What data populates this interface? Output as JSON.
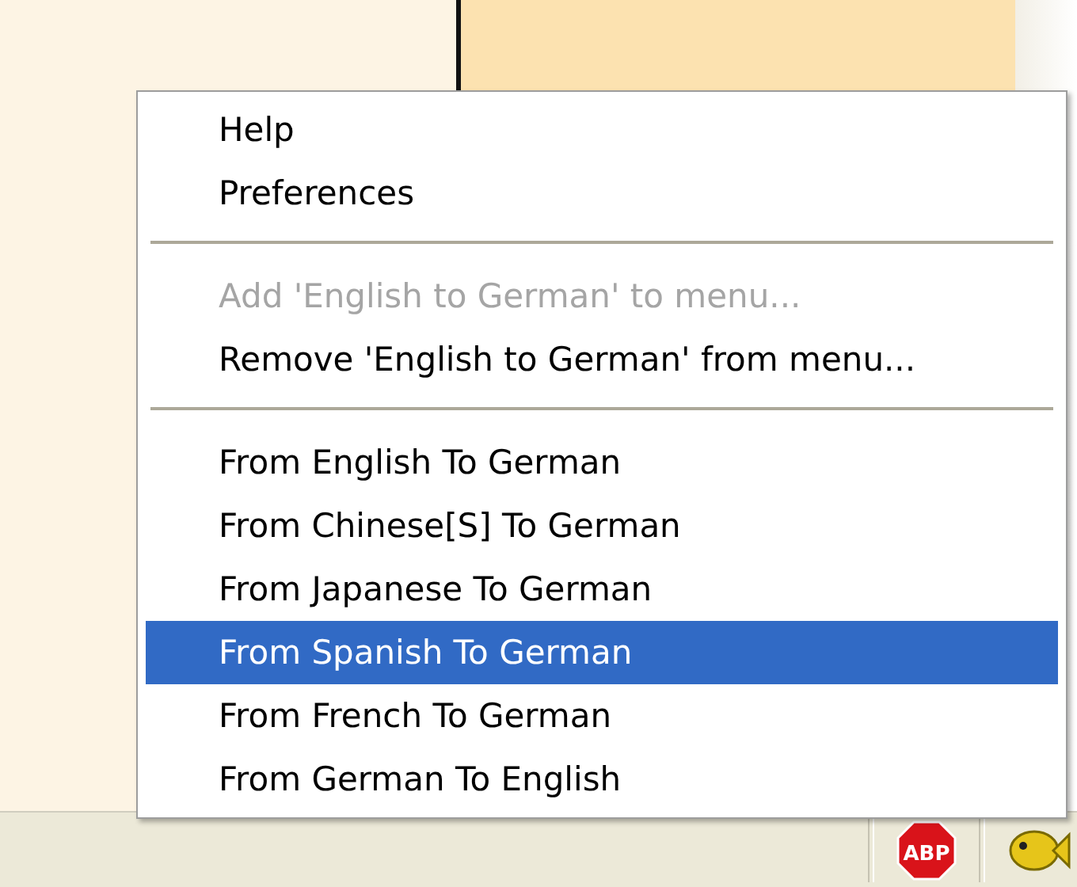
{
  "menu": {
    "items": [
      {
        "kind": "item",
        "label": "Help",
        "disabled": false,
        "selected": false
      },
      {
        "kind": "item",
        "label": "Preferences",
        "disabled": false,
        "selected": false
      },
      {
        "kind": "separator"
      },
      {
        "kind": "item",
        "label": "Add 'English to German' to menu...",
        "disabled": true,
        "selected": false
      },
      {
        "kind": "item",
        "label": "Remove 'English to German' from menu...",
        "disabled": false,
        "selected": false
      },
      {
        "kind": "separator"
      },
      {
        "kind": "item",
        "label": "From English To German",
        "disabled": false,
        "selected": false
      },
      {
        "kind": "item",
        "label": "From Chinese[S] To German",
        "disabled": false,
        "selected": false
      },
      {
        "kind": "item",
        "label": "From Japanese To German",
        "disabled": false,
        "selected": false
      },
      {
        "kind": "item",
        "label": "From Spanish To German",
        "disabled": false,
        "selected": true
      },
      {
        "kind": "item",
        "label": "From French To German",
        "disabled": false,
        "selected": false
      },
      {
        "kind": "item",
        "label": "From German To English",
        "disabled": false,
        "selected": false
      }
    ]
  },
  "tray": {
    "stop_badge": "ABP"
  }
}
